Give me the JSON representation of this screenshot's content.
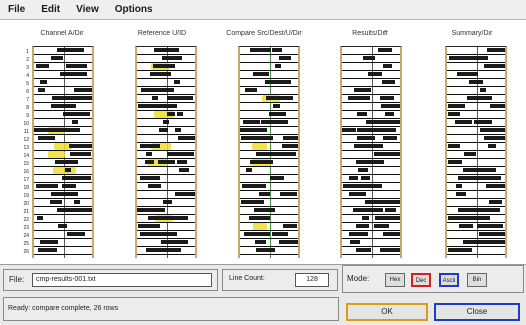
{
  "menu": {
    "file": "File",
    "edit": "Edit",
    "view": "View",
    "options": "Options"
  },
  "columns": [
    {
      "header": "Channel A/Dir"
    },
    {
      "header": "Reference U/ID"
    },
    {
      "header": "Compare Src/Dest/U/Dir"
    },
    {
      "header": "Results/Diff"
    },
    {
      "header": "Summary/Dir"
    }
  ],
  "row_numbers": [
    "1",
    "2",
    "3",
    "4",
    "5",
    "6",
    "7",
    "8",
    "9",
    "10",
    "11",
    "12",
    "13",
    "14",
    "15",
    "16",
    "17",
    "18",
    "19",
    "20",
    "21",
    "22",
    "23",
    "24",
    "25",
    "26"
  ],
  "footer": {
    "file_label": "File:",
    "file_value": "cmp-results-001.txt",
    "count_label": "Line Count:",
    "count_value": "128",
    "mode_label": "Mode:",
    "view_buttons": [
      "Hex",
      "Dec",
      "Ascii",
      "Bin"
    ],
    "status": "Ready: compare complete, 26 rows",
    "ok_label": "OK",
    "close_label": "Close"
  },
  "colors": {
    "column_border": "#c9a86a",
    "highlight": "#f0de28",
    "dec_button": "#d42020",
    "ascii_button": "#1f3cc8",
    "ok_button": "#d4a017",
    "close_button": "#1f3cc8"
  }
}
